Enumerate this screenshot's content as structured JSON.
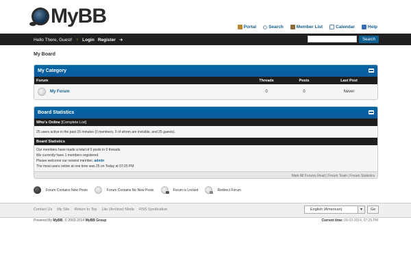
{
  "header": {
    "logo_text": "MyBB",
    "links": [
      {
        "label": "Portal",
        "icon": "portal-icon",
        "color": "#b8862e"
      },
      {
        "label": "Search",
        "icon": "search-icon",
        "color": "#6a8fb5"
      },
      {
        "label": "Member List",
        "icon": "member-list-icon",
        "color": "#8a6a3a"
      },
      {
        "label": "Calendar",
        "icon": "calendar-icon",
        "color": "#5a84b8"
      },
      {
        "label": "Help",
        "icon": "help-icon",
        "color": "#3a6cb0"
      }
    ]
  },
  "panel": {
    "welcome": "Hello There, Guest!",
    "login": "Login",
    "register": "Register",
    "search_button": "Search"
  },
  "breadcrumb": "My Board",
  "category": {
    "title": "My Category",
    "columns": [
      "Forum",
      "Threads",
      "Posts",
      "Last Post"
    ],
    "forums": [
      {
        "name": "My Forum",
        "threads": "0",
        "posts": "0",
        "last_post": "Never"
      }
    ]
  },
  "stats": {
    "title": "Board Statistics",
    "whos_online_label": "Who's Online",
    "complete_list": "[Complete List]",
    "online_text": "25 users active in the past 15 minutes (0 members, 0 of whom are invisible, and 25 guests).",
    "section_title": "Board Statistics",
    "line1": "Our members have made a total of 0 posts in 0 threads.",
    "line2": "We currently have 1 members registered.",
    "line3_prefix": "Please welcome our newest member,",
    "newest_member": "admin",
    "line4": "The most users online at one time was 25 on Today at 07:25 PM",
    "bottom_links": "Mark All Forums Read | Forum Team | Forum Statistics"
  },
  "legend": [
    {
      "label": "Forum Contains New Posts"
    },
    {
      "label": "Forum Contains No New Posts"
    },
    {
      "label": "Forum is Locked"
    },
    {
      "label": "Redirect Forum"
    }
  ],
  "footer": {
    "links": [
      "Contact Us",
      "My Site",
      "Return to Top",
      "Lite (Archive) Mode",
      "RSS Syndication"
    ],
    "language": "English (American)",
    "go": "Go",
    "powered_prefix": "Powered By",
    "powered_brand": "MyBB",
    "powered_suffix": ", © 2002-2014",
    "powered_group": "MyBB Group",
    "current_time_label": "Current time:",
    "current_time": "09-03-2014, 07:25 PM"
  },
  "colors": {
    "accent": "#0f5ba0",
    "bar": "#202020"
  }
}
